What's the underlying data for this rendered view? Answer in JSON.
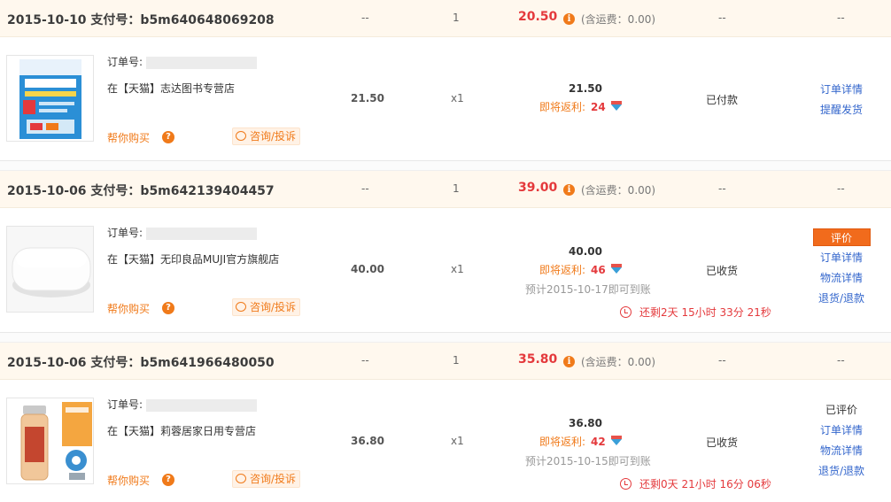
{
  "labels": {
    "order_no": "订单号:",
    "help_buy": "帮你购买",
    "consult": "咨询/投诉",
    "rebate": "即将返利:",
    "dash": "--"
  },
  "orders": [
    {
      "head": {
        "date_pay": "2015-10-10 支付号：b5m640648069208",
        "qty": "1",
        "total": "20.50",
        "shipping": "(含运费：0.00)"
      },
      "shop": "在【天猫】志达图书专营店",
      "unit_price": "21.50",
      "qty": "x1",
      "item_total": "21.50",
      "rebate_amount": "24",
      "status": "已付款",
      "actions": [
        "订单详情",
        "提醒发货"
      ]
    },
    {
      "head": {
        "date_pay": "2015-10-06 支付号：b5m642139404457",
        "qty": "1",
        "total": "39.00",
        "shipping": "(含运费：0.00)"
      },
      "shop": "在【天猫】无印良品MUJI官方旗舰店",
      "unit_price": "40.00",
      "qty": "x1",
      "item_total": "40.00",
      "rebate_amount": "46",
      "arrive": "预计2015-10-17即可到账",
      "countdown": "还剩2天 15小时 33分 21秒",
      "status": "已收货",
      "review_button": "评价",
      "actions": [
        "订单详情",
        "物流详情",
        "退货/退款"
      ]
    },
    {
      "head": {
        "date_pay": "2015-10-06 支付号：b5m641966480050",
        "qty": "1",
        "total": "35.80",
        "shipping": "(含运费：0.00)"
      },
      "shop": "在【天猫】莉蓉居家日用专营店",
      "unit_price": "36.80",
      "qty": "x1",
      "item_total": "36.80",
      "rebate_amount": "42",
      "arrive": "预计2015-10-15即可到账",
      "countdown": "还剩0天 21小时 16分 06秒",
      "status": "已收货",
      "reviewed": "已评价",
      "actions": [
        "订单详情",
        "物流详情",
        "退货/退款"
      ]
    }
  ],
  "colors": {
    "accent_orange": "#f07a1a",
    "price_red": "#e4393c",
    "link_blue": "#3366cc"
  },
  "icons": [
    "info-icon",
    "help-question-icon",
    "chat-bubble-icon",
    "diamond-icon",
    "clock-icon"
  ]
}
